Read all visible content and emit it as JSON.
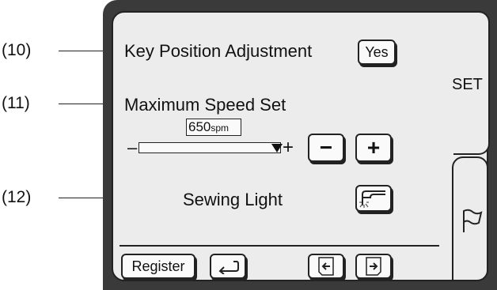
{
  "callouts": {
    "c10": "(10)",
    "c11": "(11)",
    "c12": "(12)"
  },
  "rows": {
    "key_position_label": "Key Position Adjustment",
    "key_position_button": "Yes",
    "max_speed_label": "Maximum Speed Set",
    "sewing_light_label": "Sewing Light"
  },
  "speed": {
    "value_number": "650",
    "value_unit": "spm",
    "minus_sign": "–",
    "plus_sign": "+",
    "decrease_button": "−",
    "increase_button": "+",
    "dropdown_icon": "triangle-down-icon"
  },
  "tabs": {
    "set_tab": "SET",
    "flag_tab_icon": "flag-icon"
  },
  "footer": {
    "register_button": "Register",
    "return_icon": "return-arrow-icon",
    "prev_page_icon": "page-left-arrow-icon",
    "next_page_icon": "page-right-arrow-icon"
  },
  "icons": {
    "sewing_light_icon": "sewing-light-icon"
  }
}
